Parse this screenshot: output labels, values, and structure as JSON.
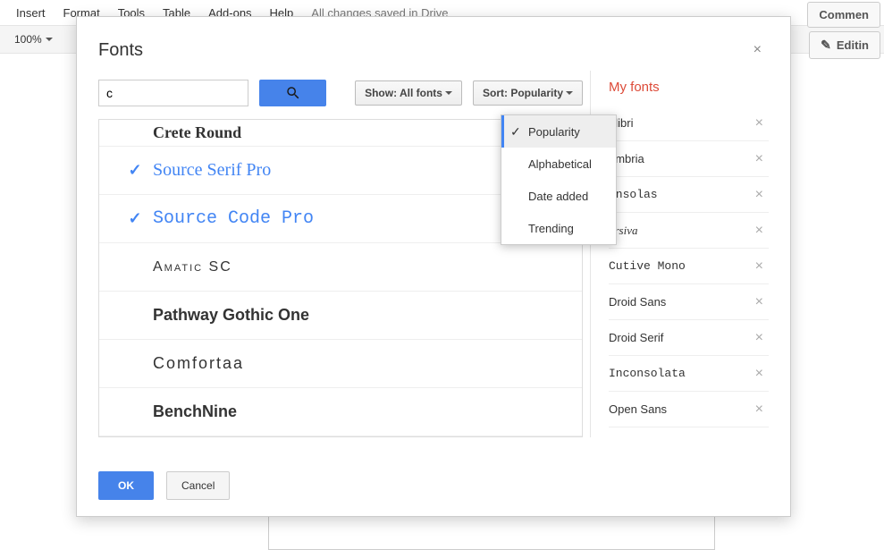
{
  "menubar": {
    "items": [
      "Insert",
      "Format",
      "Tools",
      "Table",
      "Add-ons",
      "Help"
    ],
    "save_status": "All changes saved in Drive"
  },
  "toolbar": {
    "zoom": "100%",
    "comments_btn": "Commen",
    "editing_btn": "Editin"
  },
  "dialog": {
    "title": "Fonts",
    "search_value": "c",
    "show_filter": "Show: All fonts",
    "sort_filter": "Sort: Popularity",
    "ok_label": "OK",
    "cancel_label": "Cancel"
  },
  "sort_menu": {
    "items": [
      "Popularity",
      "Alphabetical",
      "Date added",
      "Trending"
    ],
    "selected_index": 0
  },
  "fonts": [
    {
      "name": "Crete Round",
      "selected": false,
      "style": "font-crete"
    },
    {
      "name": "Source Serif Pro",
      "selected": true,
      "style": "font-sourceserif"
    },
    {
      "name": "Source Code Pro",
      "selected": true,
      "style": "font-sourcecode"
    },
    {
      "name": "Amatic SC",
      "selected": false,
      "style": "font-amatic"
    },
    {
      "name": "Pathway Gothic One",
      "selected": false,
      "style": "font-pathway"
    },
    {
      "name": "Comfortaa",
      "selected": false,
      "style": "font-comfortaa"
    },
    {
      "name": "BenchNine",
      "selected": false,
      "style": "font-bench"
    }
  ],
  "myfonts": {
    "title": "My fonts",
    "items": [
      {
        "name": "alibri",
        "style": ""
      },
      {
        "name": "ambria",
        "style": ""
      },
      {
        "name": "onsolas",
        "style": "mono"
      },
      {
        "name": "orsiva",
        "style": "script"
      },
      {
        "name": "Cutive Mono",
        "style": "mono"
      },
      {
        "name": "Droid Sans",
        "style": ""
      },
      {
        "name": "Droid Serif",
        "style": ""
      },
      {
        "name": "Inconsolata",
        "style": "mono"
      },
      {
        "name": "Open Sans",
        "style": ""
      }
    ]
  }
}
